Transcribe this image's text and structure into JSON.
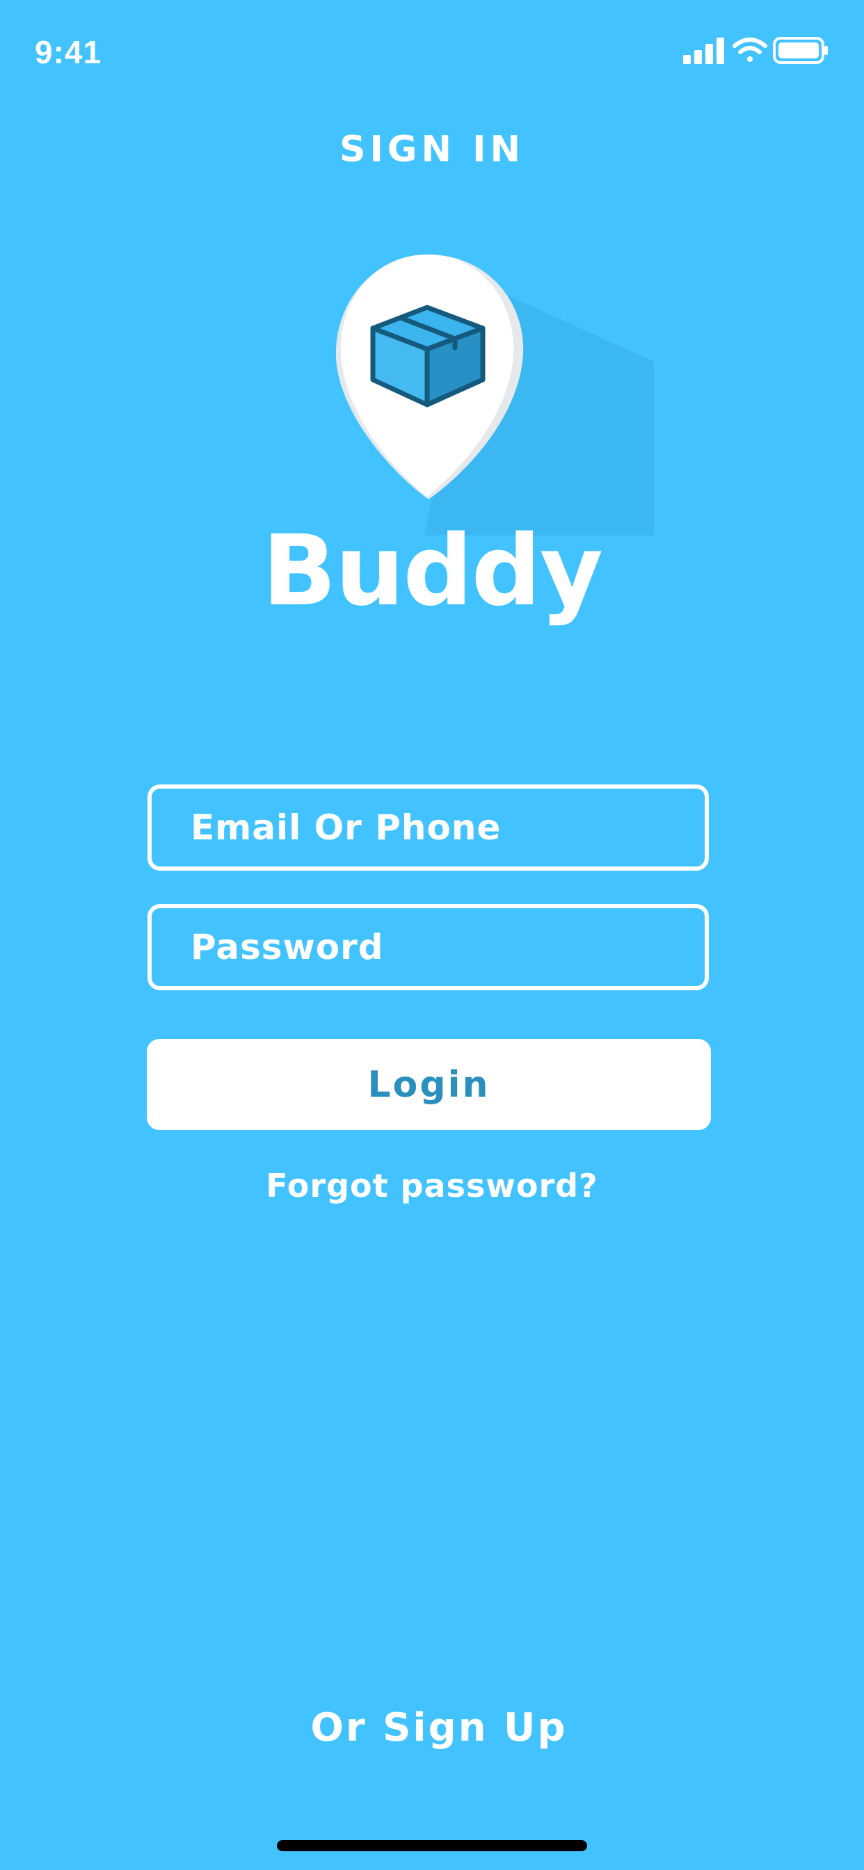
{
  "status_bar": {
    "time": "9:41",
    "icons": [
      "cellular-signal-icon",
      "wifi-icon",
      "battery-icon"
    ]
  },
  "page_title": "SIGN IN",
  "brand": {
    "name": "Buddy",
    "logo_icon": "location-pin-package-icon"
  },
  "form": {
    "email_placeholder": "Email Or Phone",
    "email_value": "",
    "password_placeholder": "Password",
    "password_value": ""
  },
  "actions": {
    "login_label": "Login",
    "forgot_password_label": "Forgot password?",
    "signup_label": "Or Sign Up"
  },
  "colors": {
    "background": "#42c3ff",
    "button_text": "#2b8fbd",
    "foreground": "#ffffff"
  }
}
